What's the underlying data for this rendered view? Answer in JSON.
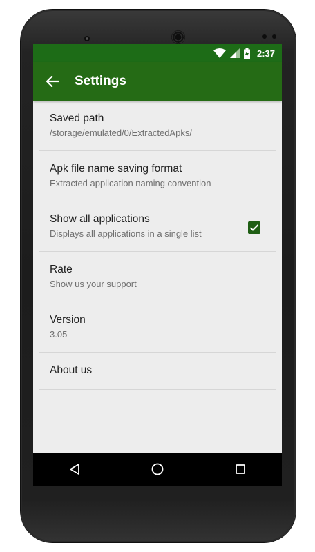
{
  "status_bar": {
    "time": "2:37",
    "icons": [
      "wifi-icon",
      "signal-icon",
      "battery-icon"
    ]
  },
  "toolbar": {
    "title": "Settings",
    "back_icon": "arrow-back-icon"
  },
  "settings": {
    "items": [
      {
        "title": "Saved path",
        "subtitle": "/storage/emulated/0/ExtractedApks/"
      },
      {
        "title": "Apk file name saving format",
        "subtitle": "Extracted application naming convention"
      },
      {
        "title": "Show all applications",
        "subtitle": "Displays all applications in a single list",
        "checked": true
      },
      {
        "title": "Rate",
        "subtitle": "Show us your support"
      },
      {
        "title": "Version",
        "subtitle": "3.05"
      },
      {
        "title": "About us"
      }
    ]
  },
  "navigation": {
    "buttons": [
      "back-triangle-icon",
      "home-circle-icon",
      "recents-square-icon"
    ]
  },
  "colors": {
    "status_bar": "#1d6c17",
    "toolbar": "#256b15",
    "accent": "#1f5e14",
    "background": "#ededed"
  }
}
